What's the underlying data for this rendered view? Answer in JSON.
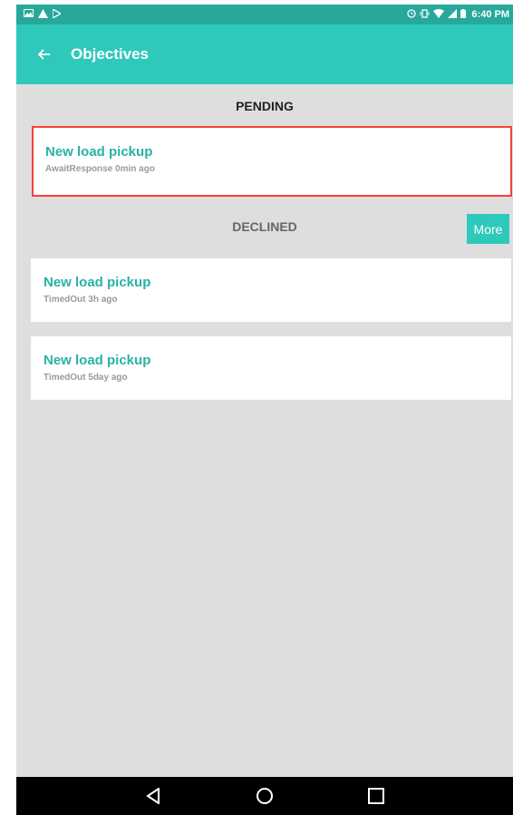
{
  "status_bar": {
    "time": "6:40 PM",
    "left_icons": [
      "image-icon",
      "warning-icon",
      "play-store-icon"
    ],
    "right_icons": [
      "alarm-icon",
      "vibrate-icon",
      "wifi-icon",
      "signal-icon",
      "battery-icon"
    ]
  },
  "app_bar": {
    "title": "Objectives",
    "back_icon": "arrow-left-icon"
  },
  "pending": {
    "title": "PENDING",
    "items": [
      {
        "title": "New load pickup",
        "subtitle": "AwaitResponse 0min ago"
      }
    ]
  },
  "declined": {
    "title": "DECLINED",
    "more_label": "More",
    "items": [
      {
        "title": "New load pickup",
        "subtitle": "TimedOut 3h ago"
      },
      {
        "title": "New load pickup",
        "subtitle": "TimedOut 5day ago"
      }
    ]
  },
  "nav_bar": {
    "icons": [
      "back-triangle-icon",
      "home-circle-icon",
      "recents-square-icon"
    ]
  },
  "colors": {
    "accent": "#2ec9bb",
    "status_bar": "#27a89b",
    "highlight": "#f44336",
    "background": "#dedede"
  }
}
